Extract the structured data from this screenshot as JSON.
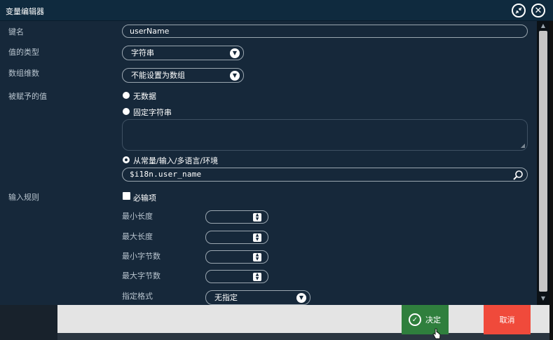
{
  "window": {
    "title": "变量编辑器"
  },
  "form": {
    "key_name": {
      "label": "键名",
      "value": "userName"
    },
    "value_type": {
      "label": "值的类型",
      "selected": "字符串"
    },
    "array_dims": {
      "label": "数组维数",
      "selected": "不能设置为数组"
    },
    "assigned_value": {
      "label": "被赋予的值",
      "options": [
        {
          "label": "无数据",
          "checked": false
        },
        {
          "label": "固定字符串",
          "checked": false
        },
        {
          "label": "从常量/输入/多语言/环境",
          "checked": true
        }
      ],
      "fixed_text": "",
      "source_value": "$i18n.user_name"
    },
    "input_rules": {
      "label": "输入规则",
      "required_label": "必输项",
      "required_checked": false,
      "min_length_label": "最小长度",
      "max_length_label": "最大长度",
      "min_bytes_label": "最小字节数",
      "max_bytes_label": "最大字节数",
      "format_label": "指定格式",
      "format_selected": "无指定"
    }
  },
  "footer": {
    "ok_label": "决定",
    "cancel_label": "取消"
  },
  "colors": {
    "ok": "#2f7f3d",
    "cancel": "#f04a3b",
    "titlebar": "#0f2a3e"
  }
}
